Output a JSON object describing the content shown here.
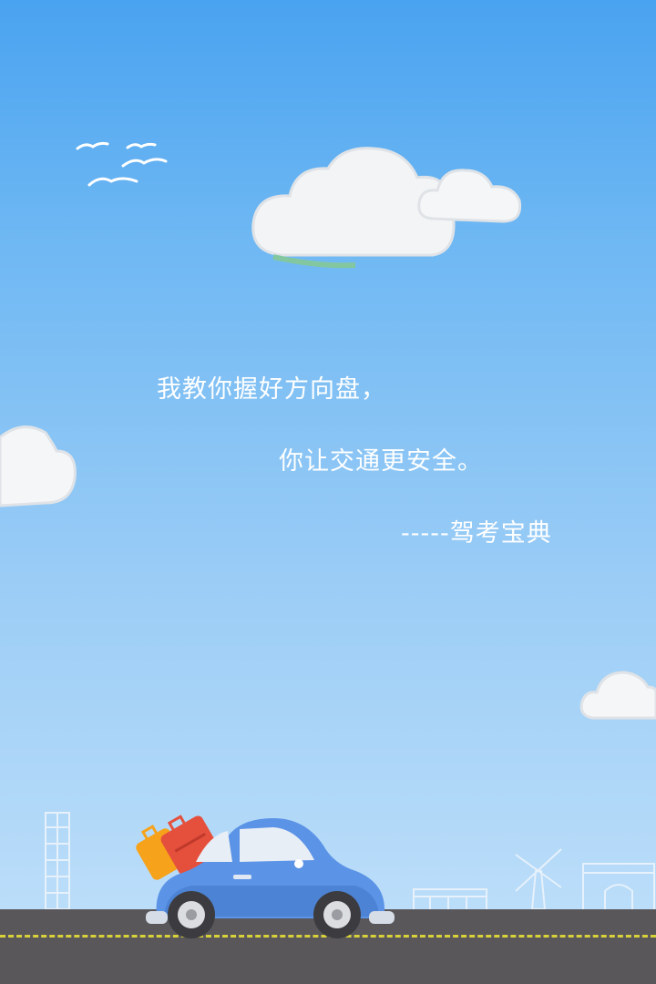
{
  "quote": {
    "line1": "我教你握好方向盘，",
    "line2": "你让交通更安全。",
    "signature": "-----驾考宝典"
  },
  "icons": [
    "birds-icon",
    "cloud-icon",
    "car-icon",
    "luggage-icon",
    "tower-icon",
    "windmill-icon",
    "arch-icon"
  ],
  "colors": {
    "sky_top": "#4aa3f0",
    "sky_bottom": "#c2e1fa",
    "road": "#59575a",
    "lane": "#d8d23a",
    "car": "#5b93e6"
  }
}
